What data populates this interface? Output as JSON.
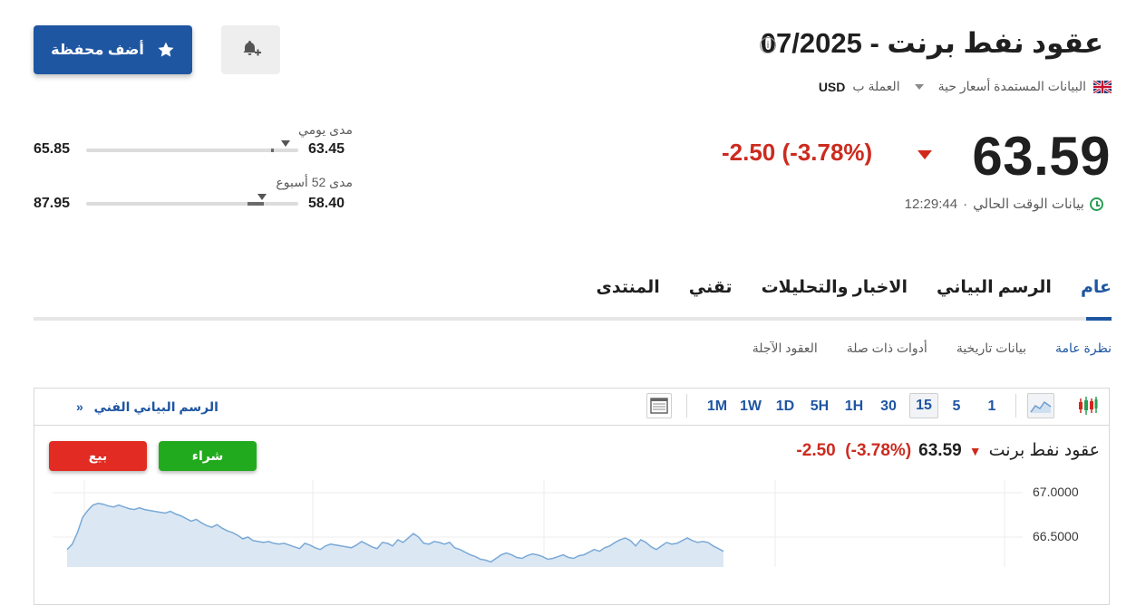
{
  "header": {
    "title": "عقود نفط برنت - 07/2025",
    "info_icon": "info-icon",
    "data_source": "البيانات المستمدة أسعار حية",
    "currency_label": "العملة ب",
    "currency_code": "USD"
  },
  "buttons": {
    "watchlist": "أضف محفظة",
    "watchlist_icon": "star-icon",
    "alert_icon": "bell-plus-icon"
  },
  "quote": {
    "price": "63.59",
    "change": "-2.50",
    "change_pct": "(-3.78%)",
    "time": "12:29:44",
    "time_label": "بيانات الوقت الحالي"
  },
  "ranges": {
    "daily": {
      "label": "مدى يومي",
      "low": "63.45",
      "high": "65.85",
      "position": 0.06
    },
    "week52": {
      "label": "مدى 52 أسبوع",
      "low": "58.40",
      "high": "87.95",
      "position": 0.17
    }
  },
  "tabs": [
    {
      "label": "عام",
      "active": true
    },
    {
      "label": "الرسم البياني",
      "active": false
    },
    {
      "label": "الاخبار والتحليلات",
      "active": false
    },
    {
      "label": "تقني",
      "active": false
    },
    {
      "label": "المنتدى",
      "active": false
    }
  ],
  "subtabs": [
    {
      "label": "نظرة عامة",
      "active": true
    },
    {
      "label": "بيانات تاريخية",
      "active": false
    },
    {
      "label": "أدوات ذات صلة",
      "active": false
    },
    {
      "label": "العقود الآجلة",
      "active": false
    }
  ],
  "chart_toolbar": {
    "timeframes": [
      "1",
      "5",
      "15",
      "30",
      "1H",
      "5H",
      "1D",
      "1W",
      "1M"
    ],
    "active_timeframe": "15",
    "technical_link": "الرسم البياني الفني",
    "technical_link_arrow": "»"
  },
  "chart_header": {
    "name": "عقود نفط برنت",
    "price": "63.59",
    "change": "-2.50",
    "change_pct": "(-3.78%)",
    "buy": "شراء",
    "sell": "بيع"
  },
  "colors": {
    "accent": "#1f56a2",
    "negative": "#cc2b1f",
    "buy": "#22aa1e",
    "sell": "#e22b22",
    "chart_line": "#7aa9d6",
    "chart_fill": "#dbe8f4"
  },
  "chart_data": {
    "type": "area",
    "ylim": [
      66.35,
      67.1
    ],
    "yticks": [
      "67.0000",
      "66.5000"
    ],
    "yticks_values": [
      67.0,
      66.5
    ],
    "values": [
      66.36,
      66.42,
      66.55,
      66.72,
      66.8,
      66.86,
      66.88,
      66.87,
      66.85,
      66.84,
      66.86,
      66.84,
      66.82,
      66.81,
      66.83,
      66.81,
      66.8,
      66.79,
      66.78,
      66.77,
      66.79,
      66.76,
      66.74,
      66.71,
      66.68,
      66.7,
      66.66,
      66.63,
      66.61,
      66.64,
      66.6,
      66.57,
      66.55,
      66.52,
      66.48,
      66.5,
      66.46,
      66.45,
      66.44,
      66.45,
      66.43,
      66.42,
      66.43,
      66.41,
      66.39,
      66.37,
      66.43,
      66.41,
      66.38,
      66.36,
      66.4,
      66.42,
      66.41,
      66.4,
      66.39,
      66.38,
      66.41,
      66.45,
      66.42,
      66.39,
      66.37,
      66.44,
      66.43,
      66.4,
      66.47,
      66.44,
      66.49,
      66.54,
      66.5,
      66.43,
      66.42,
      66.45,
      66.44,
      66.42,
      66.44,
      66.38,
      66.36,
      66.33,
      66.3,
      66.28,
      66.25,
      66.24,
      66.22,
      66.26,
      66.3,
      66.32,
      66.3,
      66.27,
      66.26,
      66.29,
      66.31,
      66.3,
      66.28,
      66.25,
      66.26,
      66.28,
      66.3,
      66.27,
      66.26,
      66.29,
      66.3,
      66.33,
      66.36,
      66.34,
      66.38,
      66.4,
      66.44,
      66.47,
      66.49,
      66.46,
      66.4,
      66.47,
      66.44,
      66.39,
      66.36,
      66.4,
      66.44,
      66.42,
      66.43,
      66.46,
      66.49,
      66.46,
      66.44,
      66.45,
      66.44,
      66.4,
      66.37,
      66.34
    ]
  }
}
